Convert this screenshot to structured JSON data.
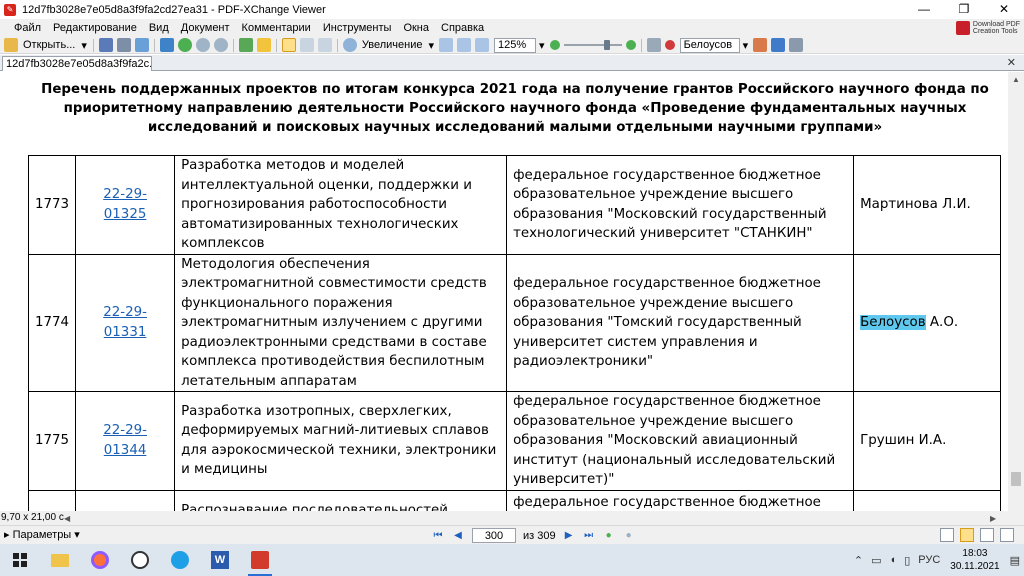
{
  "window": {
    "title": "12d7fb3028e7e05d8a3f9fa2cd27ea31 - PDF-XChange Viewer",
    "minimize": "—",
    "restore": "❐",
    "close": "✕"
  },
  "menu": [
    "Файл",
    "Редактирование",
    "Вид",
    "Документ",
    "Комментарии",
    "Инструменты",
    "Окна",
    "Справка"
  ],
  "promo": {
    "line1": "Download PDF",
    "line2": "Creation Tools"
  },
  "toolbar": {
    "open_label": "Открыть...",
    "zoom_label": "Увеличение",
    "zoom_value": "125%",
    "search_value": "Белоусов"
  },
  "tab": {
    "label": "12d7fb3028e7e05d8a3f9fa2c...",
    "close": "✕"
  },
  "document": {
    "heading": "Перечень поддержанных проектов по итогам конкурса 2021 года на получение грантов Российского научного фонда по приоритетному направлению деятельности Российского научного фонда «Проведение фундаментальных научных исследований и поисковых научных исследований малыми отдельными научными группами»",
    "rows": [
      {
        "num": "1773",
        "code": "22-29-01325",
        "theme": "Разработка методов и моделей интеллектуальной оценки, поддержки и прогнозирования работоспособности автоматизированных технологических комплексов",
        "org": "федеральное государственное бюджетное образовательное учреждение высшего образования \"Московский государственный технологический университет \"СТАНКИН\"",
        "lead_hl": "",
        "lead_rest": "Мартинова Л.И."
      },
      {
        "num": "1774",
        "code": "22-29-01331",
        "theme": "Методология обеспечения электромагнитной совместимости средств функционального поражения электромагнитным излучением с другими радиоэлектронными средствами в составе комплекса противодействия беспилотным летательным аппаратам",
        "org": "федеральное государственное бюджетное образовательное учреждение высшего образования \"Томский государственный университет систем управления и радиоэлектроники\"",
        "lead_hl": "Белоусов",
        "lead_rest": " А.О."
      },
      {
        "num": "1775",
        "code": "22-29-01344",
        "theme": "Разработка изотропных, сверхлегких, деформируемых магний-литиевых сплавов для аэрокосмической техники, электроники и медицины",
        "org": "федеральное государственное бюджетное образовательное учреждение высшего образования \"Московский авиационный институт (национальный исследовательский университет)\"",
        "lead_hl": "",
        "lead_rest": "Грушин И.А."
      },
      {
        "num": "",
        "code": "",
        "theme": "Распознавание последовательностей",
        "org": "федеральное государственное бюджетное образовательное учреждение высшего",
        "lead_hl": "",
        "lead_rest": ""
      }
    ]
  },
  "status": {
    "page_size": "9,70 x 21,00 с"
  },
  "bottom": {
    "params_label": "Параметры",
    "current_page": "300",
    "page_of": "из 309"
  },
  "tray": {
    "lang": "РУС",
    "time": "18:03",
    "date": "30.11.2021"
  }
}
